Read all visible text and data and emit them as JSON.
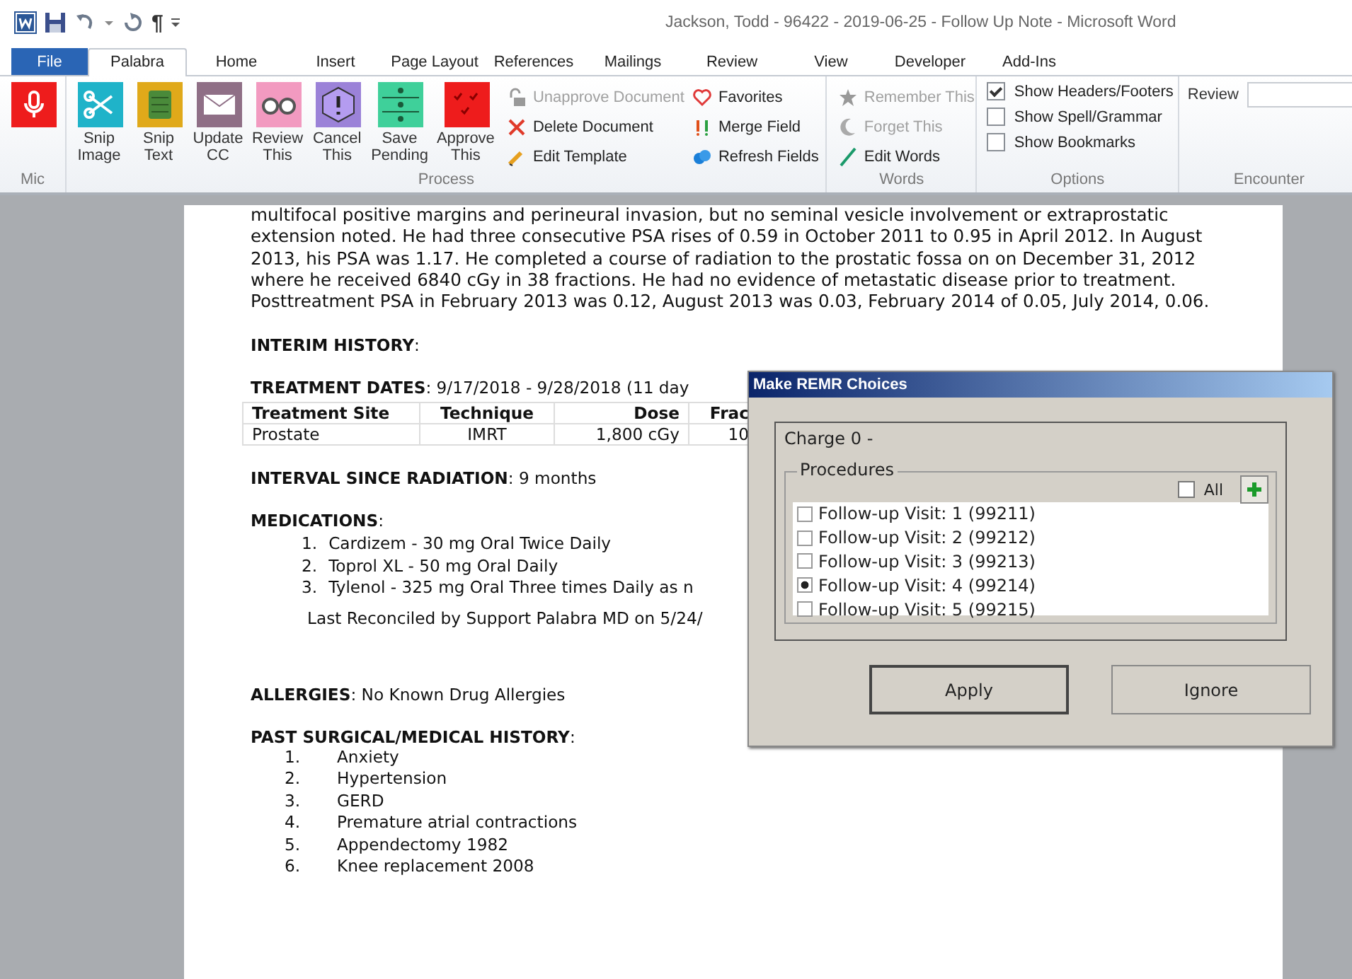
{
  "window": {
    "title": "Jackson, Todd - 96422 - 2019-06-25 - Follow Up Note  -  Microsoft Word",
    "pilcrow": "¶"
  },
  "tabs": [
    {
      "label": "File",
      "kind": "file",
      "selected": false
    },
    {
      "label": "Palabra",
      "kind": "tab",
      "selected": true
    },
    {
      "label": "Home",
      "kind": "tab",
      "selected": false
    },
    {
      "label": "Insert",
      "kind": "tab",
      "selected": false
    },
    {
      "label": "Page Layout",
      "kind": "tab",
      "selected": false
    },
    {
      "label": "References",
      "kind": "tab",
      "selected": false
    },
    {
      "label": "Mailings",
      "kind": "tab",
      "selected": false
    },
    {
      "label": "Review",
      "kind": "tab",
      "selected": false
    },
    {
      "label": "View",
      "kind": "tab",
      "selected": false
    },
    {
      "label": "Developer",
      "kind": "tab",
      "selected": false
    },
    {
      "label": "Add-Ins",
      "kind": "tab",
      "selected": false
    }
  ],
  "ribbon": {
    "groups": [
      {
        "label": "Mic",
        "kind": "mic"
      },
      {
        "label": "Process",
        "kind": "process",
        "big_buttons": [
          {
            "lines": [
              "Snip",
              "Image"
            ]
          },
          {
            "lines": [
              "Snip",
              "Text"
            ]
          },
          {
            "lines": [
              "Update",
              "CC"
            ]
          },
          {
            "lines": [
              "Review",
              "This"
            ]
          },
          {
            "lines": [
              "Cancel",
              "This"
            ]
          },
          {
            "lines": [
              "Save",
              "Pending"
            ]
          },
          {
            "lines": [
              "Approve",
              "This"
            ]
          }
        ],
        "small_buttons": [
          {
            "label": "Unapprove Document",
            "disabled": true
          },
          {
            "label": "Delete Document",
            "disabled": false
          },
          {
            "label": "Edit Template",
            "disabled": false
          },
          {
            "label": "Favorites",
            "disabled": false
          },
          {
            "label": "Merge Field",
            "disabled": false
          },
          {
            "label": "Refresh Fields",
            "disabled": false
          }
        ]
      },
      {
        "label": "Words",
        "kind": "small",
        "small_buttons": [
          {
            "label": "Remember This",
            "disabled": true
          },
          {
            "label": "Forget This",
            "disabled": true
          },
          {
            "label": "Edit Words",
            "disabled": false
          }
        ]
      },
      {
        "label": "Options",
        "kind": "options",
        "checkboxes": [
          {
            "label": "Show Headers/Footers",
            "checked": true
          },
          {
            "label": "Show Spell/Grammar",
            "checked": false
          },
          {
            "label": "Show Bookmarks",
            "checked": false
          }
        ]
      },
      {
        "label": "Encounter",
        "kind": "field",
        "field_label": "Review"
      }
    ]
  },
  "document": [
    {
      "kind": "paragraph",
      "text": "multifocal positive margins and perineural invasion, but no seminal vesicle involvement or extraprostatic extension noted. He had three consecutive PSA rises of 0.59 in October 2011 to 0.95 in April 2012.  In August 2013, his PSA was 1.17. He completed  a course of radiation to the prostatic fossa on on December 31, 2012 where he received 6840 cGy in 38 fractions. He had no evidence of metastatic disease prior to treatment. Posttreatment PSA in February 2013 was 0.12, August 2013 was 0.03, February 2014 of 0.05, July 2014, 0.06."
    },
    {
      "kind": "heading",
      "text": "**INTERIM HISTORY**:"
    },
    {
      "kind": "heading",
      "text": "**TREATMENT DATES**: 9/17/2018  - 9/28/2018 (11 day"
    },
    {
      "kind": "table",
      "columns": [
        "Treatment Site",
        "Technique",
        "Dose",
        "Frac"
      ],
      "rows": [
        [
          "Prostate",
          "IMRT",
          "1,800 cGy",
          "10"
        ]
      ]
    },
    {
      "kind": "heading",
      "text": "**INTERVAL SINCE RADIATION**: 9 months"
    },
    {
      "kind": "heading",
      "text": "**MEDICATIONS**:"
    },
    {
      "kind": "med_list",
      "items": [
        {
          "number": "1.",
          "text": "Cardizem - 30 mg Oral Twice Daily"
        },
        {
          "number": "2.",
          "text": "Toprol XL - 50 mg Oral Daily"
        },
        {
          "number": "3.",
          "text": "Tylenol - 325 mg Oral Three times Daily  as n"
        }
      ]
    },
    {
      "kind": "note",
      "text": "Last Reconciled by Support Palabra MD on 5/24/"
    },
    {
      "kind": "heading",
      "text": "**ALLERGIES**: No Known Drug Allergies"
    },
    {
      "kind": "heading",
      "text": "**PAST SURGICAL/MEDICAL  HISTORY**:"
    },
    {
      "kind": "numbered_list",
      "items": [
        {
          "number": "1.",
          "text": "Anxiety"
        },
        {
          "number": "2.",
          "text": "Hypertension"
        },
        {
          "number": "3.",
          "text": "GERD"
        },
        {
          "number": "4.",
          "text": "Premature atrial contractions"
        },
        {
          "number": "5.",
          "text": "Appendectomy 1982"
        },
        {
          "number": "6.",
          "text": "Knee replacement 2008"
        }
      ]
    }
  ],
  "dialog": {
    "title": "Make REMR Choices",
    "charge": "Charge 0 -",
    "group_label": "Procedures",
    "all": {
      "label": "All",
      "checked": false
    },
    "procedures": [
      {
        "label": "Follow-up Visit: 1 (99211)",
        "checked": false
      },
      {
        "label": "Follow-up Visit: 2 (99212)",
        "checked": false
      },
      {
        "label": "Follow-up Visit: 3 (99213)",
        "checked": false
      },
      {
        "label": "Follow-up Visit: 4 (99214)",
        "checked": true
      },
      {
        "label": "Follow-up Visit: 5 (99215)",
        "checked": false
      }
    ],
    "buttons": [
      {
        "label": "Apply",
        "default": true
      },
      {
        "label": "Ignore",
        "default": false
      }
    ]
  }
}
